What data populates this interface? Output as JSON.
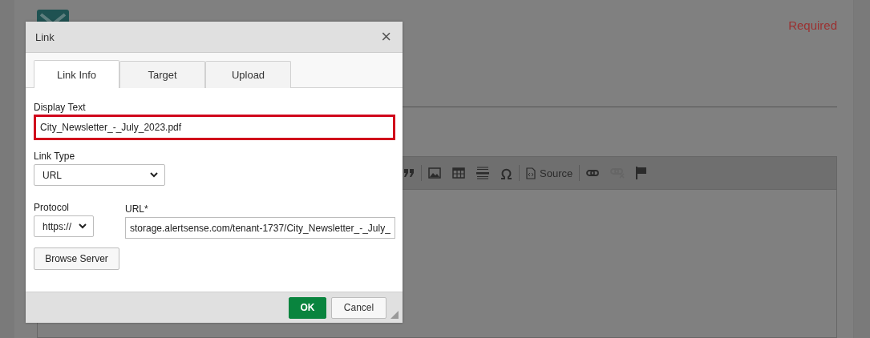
{
  "page": {
    "required_note": "Required"
  },
  "editor_toolbar": {
    "groups": [
      [
        {
          "kind": "quote",
          "disabled": false
        }
      ],
      [
        {
          "kind": "image",
          "disabled": false
        },
        {
          "kind": "table",
          "disabled": false
        },
        {
          "kind": "rule",
          "disabled": false
        },
        {
          "kind": "omega",
          "disabled": false
        }
      ],
      [
        {
          "kind": "source",
          "label": "Source",
          "disabled": false
        }
      ],
      [
        {
          "kind": "link",
          "disabled": false
        },
        {
          "kind": "unlink",
          "disabled": true
        },
        {
          "kind": "flag",
          "disabled": false
        }
      ]
    ]
  },
  "dialog": {
    "title": "Link",
    "close": "×",
    "tabs": [
      {
        "label": "Link Info",
        "selected": true
      },
      {
        "label": "Target",
        "selected": false
      },
      {
        "label": "Upload",
        "selected": false
      }
    ],
    "display_text": {
      "label": "Display Text",
      "value": "City_Newsletter_-_July_2023.pdf",
      "highlighted": true
    },
    "link_type": {
      "label": "Link Type",
      "value": "URL"
    },
    "protocol": {
      "label": "Protocol",
      "value": "https://"
    },
    "url": {
      "label": "URL*",
      "value": "storage.alertsense.com/tenant-1737/City_Newsletter_-_July_"
    },
    "browse_button": "Browse Server",
    "buttons": [
      {
        "label": "OK",
        "kind": "primary"
      },
      {
        "label": "Cancel",
        "kind": "secondary"
      }
    ]
  }
}
